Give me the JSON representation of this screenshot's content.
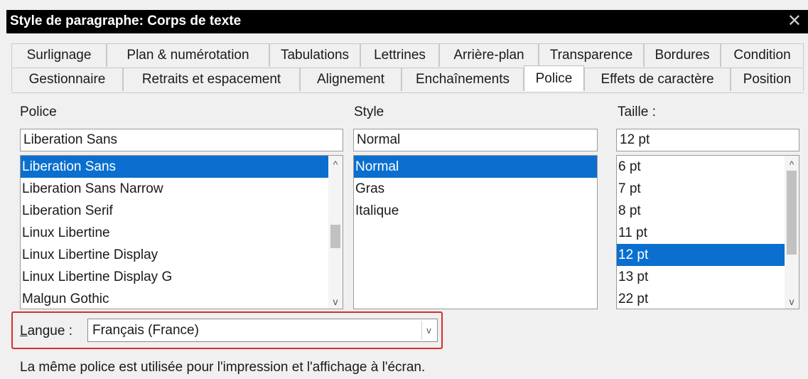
{
  "window": {
    "title": "Style de paragraphe: Corps de texte",
    "close_glyph": "✕"
  },
  "tabs": {
    "row1": [
      "Surlignage",
      "Plan & numérotation",
      "Tabulations",
      "Lettrines",
      "Arrière-plan",
      "Transparence",
      "Bordures",
      "Condition"
    ],
    "row2": [
      "Gestionnaire",
      "Retraits et espacement",
      "Alignement",
      "Enchaînements",
      "Police",
      "Effets de caractère",
      "Position"
    ],
    "active": "Police"
  },
  "font": {
    "label": "Police",
    "value": "Liberation Sans",
    "list": [
      "Liberation Sans",
      "Liberation Sans Narrow",
      "Liberation Serif",
      "Linux Libertine",
      "Linux Libertine Display",
      "Linux Libertine Display G",
      "Malgun Gothic"
    ],
    "selected": "Liberation Sans"
  },
  "style": {
    "label": "Style",
    "value": "Normal",
    "list": [
      "Normal",
      "Gras",
      "Italique"
    ],
    "selected": "Normal"
  },
  "size": {
    "label": "Taille :",
    "value": "12 pt",
    "list": [
      "6 pt",
      "7 pt",
      "8 pt",
      "11 pt",
      "12 pt",
      "13 pt",
      "22 pt"
    ],
    "selected": "12 pt"
  },
  "language": {
    "label_first": "L",
    "label_rest": "angue :",
    "value": "Français (France)"
  },
  "footnote": "La même police est utilisée pour l'impression et l'affichage à l'écran.",
  "colors": {
    "selection": "#0a6fcf",
    "highlight_border": "#d32f2f",
    "titlebar": "#000000"
  },
  "icons": {
    "scroll_up": "chevron-up-icon",
    "scroll_down": "chevron-down-icon",
    "dropdown": "chevron-down-icon"
  }
}
